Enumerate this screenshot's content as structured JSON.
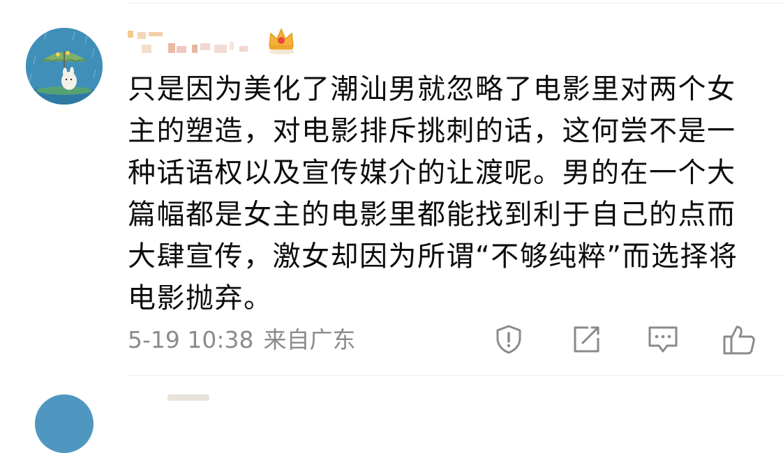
{
  "comment": {
    "body": "只是因为美化了潮汕男就忽略了电影里对两个女主的塑造，对电影排斥挑刺的话，这何尝不是一种话语权以及宣传媒介的让渡呢。男的在一个大篇幅都是女主的电影里都能找到利于自己的点而大肆宣传，激女却因为所谓“不够纯粹”而选择将电影抛弃。",
    "timestamp": "5-19 10:38",
    "location": "来自广东"
  },
  "actions": {
    "report_icon": "shield-alert-icon",
    "share_icon": "share-icon",
    "reply_icon": "comment-icon",
    "like_icon": "thumbs-up-icon"
  },
  "colors": {
    "text": "#0d0d0d",
    "meta": "#8b8b8b",
    "icon": "#8a8a8a",
    "divider": "#ececec"
  }
}
